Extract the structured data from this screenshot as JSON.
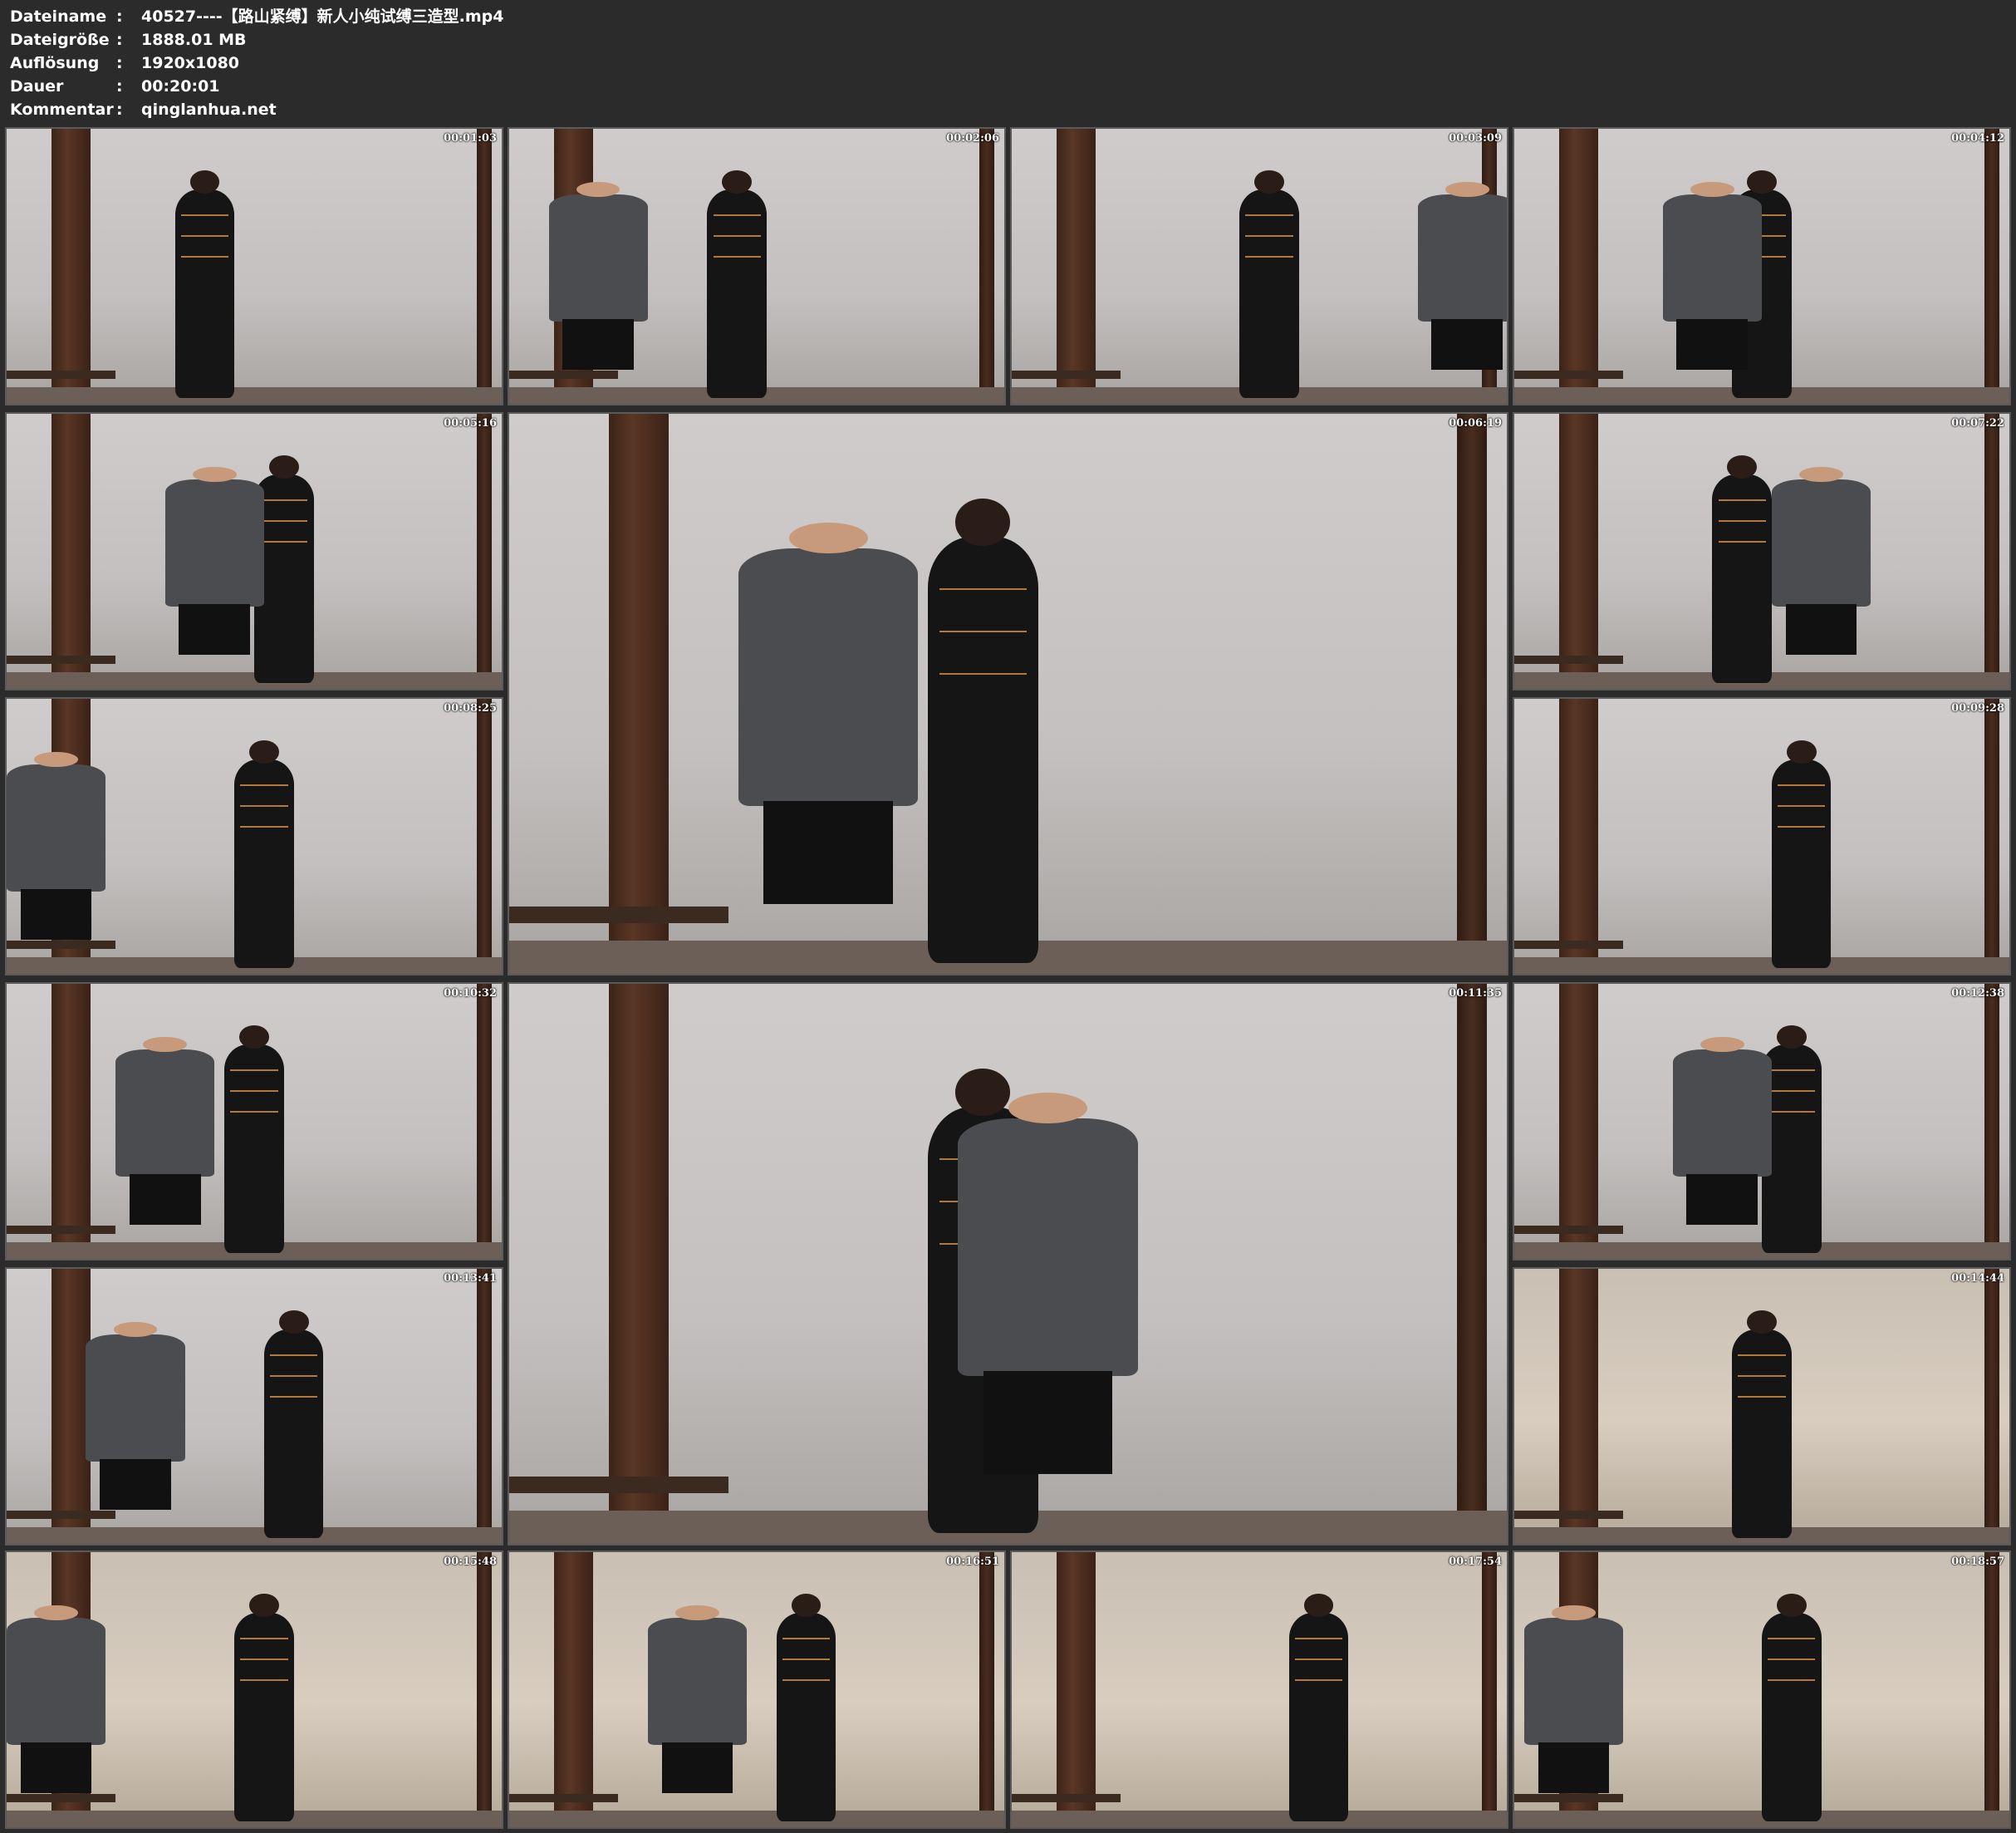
{
  "header": {
    "rows": [
      {
        "key": "Dateiname",
        "sep": ":",
        "value": "40527----【路山紧缚】新人小纯试缚三造型.mp4"
      },
      {
        "key": "Dateigröße",
        "sep": ":",
        "value": "1888.01 MB"
      },
      {
        "key": "Auflösung",
        "sep": ":",
        "value": "1920x1080"
      },
      {
        "key": "Dauer",
        "sep": ":",
        "value": "00:20:01"
      },
      {
        "key": "Kommentar",
        "sep": ":",
        "value": "qinglanhua.net"
      }
    ]
  },
  "thumbnails": [
    {
      "timestamp": "00:01:03"
    },
    {
      "timestamp": "00:02:06"
    },
    {
      "timestamp": "00:03:09"
    },
    {
      "timestamp": "00:04:12"
    },
    {
      "timestamp": "00:05:16"
    },
    {
      "timestamp": "00:06:19"
    },
    {
      "timestamp": "00:07:22"
    },
    {
      "timestamp": "00:08:25"
    },
    {
      "timestamp": "00:09:28"
    },
    {
      "timestamp": "00:10:32"
    },
    {
      "timestamp": "00:11:35"
    },
    {
      "timestamp": "00:12:38"
    },
    {
      "timestamp": "00:13:41"
    },
    {
      "timestamp": "00:14:44"
    },
    {
      "timestamp": "00:15:48"
    },
    {
      "timestamp": "00:16:51"
    },
    {
      "timestamp": "00:17:54"
    },
    {
      "timestamp": "00:18:57"
    }
  ]
}
